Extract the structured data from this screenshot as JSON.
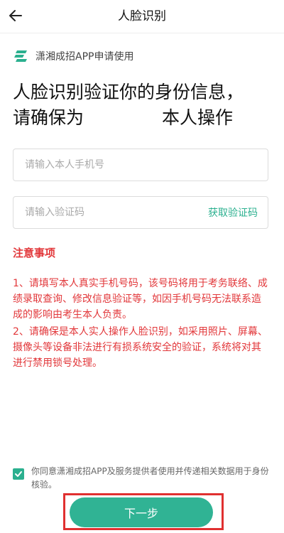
{
  "header": {
    "title": "人脸识别"
  },
  "app": {
    "name": "潇湘成招APP申请使用",
    "logo_icon": "app-logo-icon"
  },
  "headline": {
    "line1": "人脸识别验证你的身份信息，",
    "line2_prefix": "请确保为",
    "line2_suffix": "本人操作"
  },
  "form": {
    "phone_placeholder": "请输入本人手机号",
    "phone_value": "",
    "code_placeholder": "请输入验证码",
    "code_value": "",
    "get_code_label": "获取验证码"
  },
  "notice": {
    "title": "注意事项",
    "item1": "1、请填写本人真实手机号码，该号码将用于考务联络、成绩录取查询、修改信息验证等，如因手机号码无法联系造成的影响由考生本人负责。",
    "item2": "2、请确保是本人实人操作人脸识别，如采用照片、屏幕、摄像头等设备非法进行有损系统安全的验证，系统将对其进行禁用锁号处理。"
  },
  "consent": {
    "checked": true,
    "text": "你同意潇湘成招APP及服务提供者使用并传递相关数据用于身份核验。"
  },
  "footer": {
    "next_label": "下一步"
  },
  "colors": {
    "accent": "#30b394",
    "warning": "#e2373a",
    "highlight": "#e03030"
  }
}
